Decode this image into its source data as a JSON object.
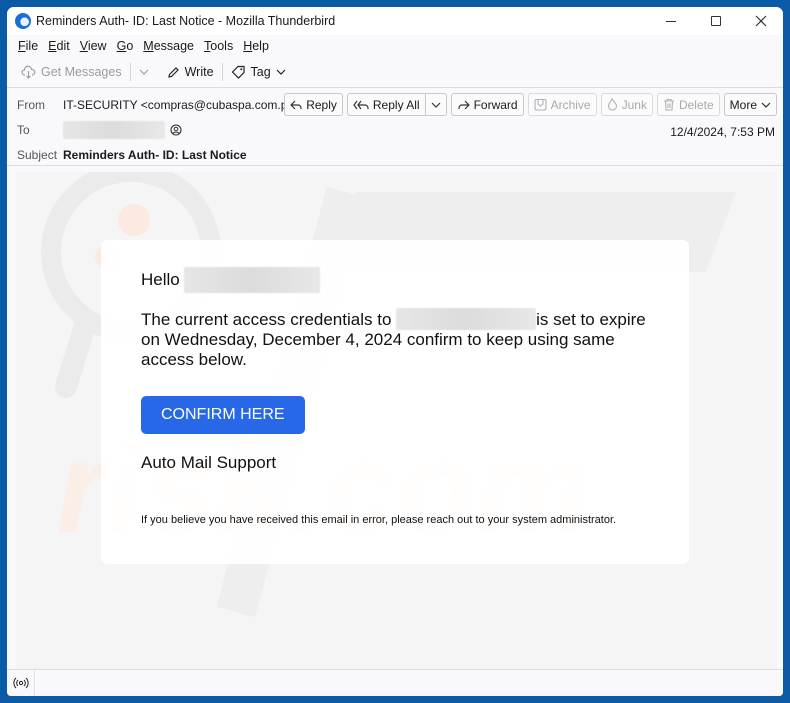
{
  "window": {
    "title": "Reminders Auth- ID: Last Notice - Mozilla Thunderbird",
    "controls": {
      "minimize": "minimize-icon",
      "maximize": "maximize-icon",
      "close": "close-icon"
    }
  },
  "menubar": {
    "items": [
      {
        "label": "File",
        "accel": "F"
      },
      {
        "label": "Edit",
        "accel": "E"
      },
      {
        "label": "View",
        "accel": "V"
      },
      {
        "label": "Go",
        "accel": "G"
      },
      {
        "label": "Message",
        "accel": "M"
      },
      {
        "label": "Tools",
        "accel": "T"
      },
      {
        "label": "Help",
        "accel": "H"
      }
    ]
  },
  "toolbar": {
    "get_messages": "Get Messages",
    "write": "Write",
    "tag": "Tag"
  },
  "header": {
    "from_label": "From",
    "from_value": "IT-SECURITY <compras@cubaspa.com.pe>",
    "to_label": "To",
    "subject_label": "Subject",
    "subject_value": "Reminders Auth- ID: Last Notice",
    "date": "12/4/2024, 7:53 PM",
    "actions": {
      "reply": "Reply",
      "reply_all": "Reply All",
      "forward": "Forward",
      "archive": "Archive",
      "junk": "Junk",
      "delete": "Delete",
      "more": "More"
    }
  },
  "message": {
    "greeting": "Hello",
    "para_before": "The current access credentials to",
    "para_after": "is set to expire on Wednesday, December 4, 2024 confirm to keep using same access below.",
    "button": "CONFIRM HERE",
    "signoff": "Auto Mail Support",
    "disclaimer": "If you believe you have received this email in error, please reach out to your system administrator.",
    "button_color": "#2767e8"
  },
  "watermark": {
    "text": "risk.com"
  },
  "statusbar": {
    "icon": "online-status-icon"
  }
}
